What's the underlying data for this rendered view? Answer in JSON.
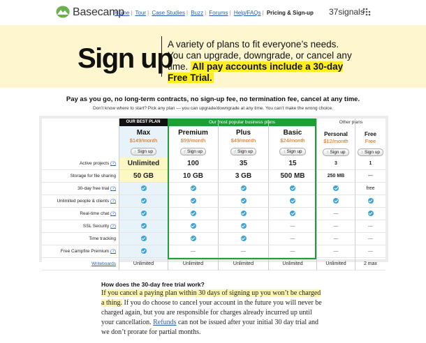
{
  "header": {
    "brand": "Basecamp",
    "nav": [
      "Home",
      "Tour",
      "Case Studies",
      "Buzz",
      "Forums",
      "Help/FAQs"
    ],
    "current": "Pricing & Sign-up",
    "company": "37signals"
  },
  "hero": {
    "title": "Sign up",
    "text": "A variety of plans to fit everyone’s needs. You can upgrade, downgrade, or cancel any time.",
    "highlight": "All pay accounts include a 30-day Free Trial."
  },
  "pitch": {
    "main": "Pay as you go, no long-term contracts, no sign-up fee, no termination fee, cancel at any time.",
    "sub": "Don’t know where to start? Pick any plan — you can upgrade/downgrade at any time. You can’t make the wrong choice."
  },
  "table": {
    "best_label": "OUR BEST PLAN",
    "popular_label": "Our most popular business plans",
    "other_label": "Other plans",
    "signup_label": "Sign up",
    "help_mark": "(?)",
    "row_labels": [
      {
        "text": "Active projects",
        "help": true
      },
      {
        "text": "Storage for file sharing",
        "help": false
      },
      {
        "text": "30-day free trial",
        "help": true
      },
      {
        "text": "Unlimited people & clients",
        "help": true
      },
      {
        "text": "Real-time chat",
        "help": true
      },
      {
        "text": "SSL Security",
        "help": true
      },
      {
        "text": "Time tracking",
        "help": false
      },
      {
        "text": "Free Campfire Premium",
        "help": true
      },
      {
        "text": "Writeboards",
        "help": false,
        "link": true
      }
    ],
    "plans": [
      {
        "name": "Max",
        "price": "$149/month",
        "values": [
          "Unlimited",
          "50 GB",
          "check",
          "check",
          "check",
          "check",
          "check",
          "check",
          "Unlimited"
        ]
      },
      {
        "name": "Premium",
        "price": "$99/month",
        "values": [
          "100",
          "10 GB",
          "check",
          "check",
          "check",
          "check",
          "check",
          "—",
          "Unlimited"
        ]
      },
      {
        "name": "Plus",
        "price": "$49/month",
        "values": [
          "35",
          "3 GB",
          "check",
          "check",
          "check",
          "check",
          "check",
          "—",
          "Unlimited"
        ]
      },
      {
        "name": "Basic",
        "price": "$24/month",
        "values": [
          "15",
          "500 MB",
          "check",
          "check",
          "check",
          "—",
          "—",
          "—",
          "Unlimited"
        ]
      },
      {
        "name": "Personal",
        "price": "$12/month",
        "values": [
          "3",
          "250 MB",
          "check",
          "check",
          "—",
          "—",
          "—",
          "—",
          "Unlimited"
        ]
      },
      {
        "name": "Free",
        "price": "Free",
        "values": [
          "1",
          "—",
          "free",
          "check",
          "check",
          "—",
          "—",
          "—",
          "2 max"
        ]
      }
    ]
  },
  "faq": {
    "question": "How does the 30-day free trial work?",
    "answer_highlight": "If you cancel a paying plan within 30 days of signing up you won’t be charged a thing.",
    "answer_rest_1": "If you do choose to cancel your account in the future you will never be charged again, but you are responsible for charges already incurred up until your cancellation.",
    "answer_link": "Refunds",
    "answer_rest_2": "can not be issued after your initial 30 day trial and we don’t prorate for partial months."
  },
  "colors": {
    "accent_green": "#1f9e36",
    "price_orange": "#d9640b",
    "check_blue": "#3fa2d6",
    "hero_bg": "#fdf6cf",
    "highlight": "#ffee1f"
  }
}
